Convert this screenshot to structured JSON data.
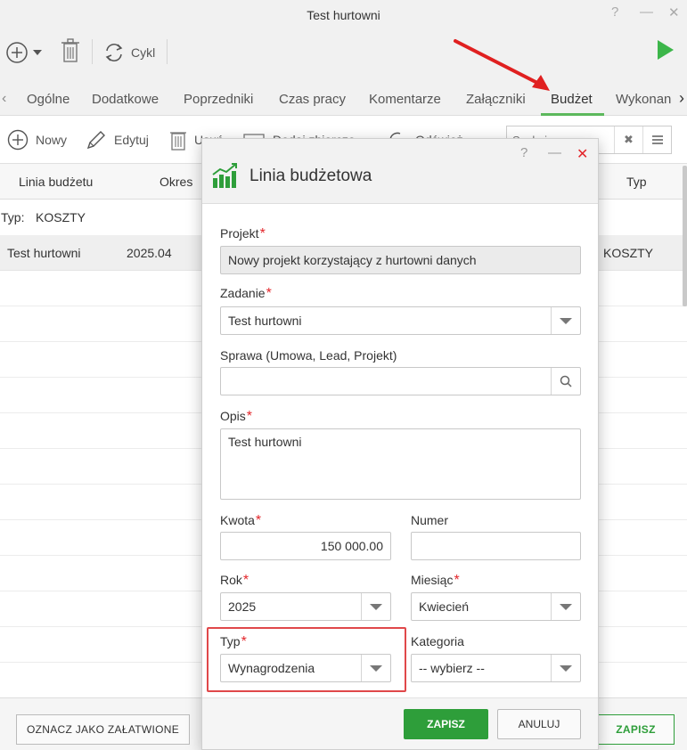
{
  "window": {
    "title": "Test hurtowni",
    "help": "?",
    "minimize": "—",
    "close": "✕"
  },
  "toolbar": {
    "cycle_label": "Cykl"
  },
  "tabs": [
    {
      "label": "Ogólne"
    },
    {
      "label": "Dodatkowe"
    },
    {
      "label": "Poprzedniki"
    },
    {
      "label": "Czas pracy"
    },
    {
      "label": "Komentarze"
    },
    {
      "label": "Załączniki"
    },
    {
      "label": "Budżet"
    },
    {
      "label": "Wykonan"
    }
  ],
  "subtoolbar": {
    "new_label": "Nowy",
    "edit_label": "Edytuj",
    "delete_label": "Usuń",
    "add_label": "Dodaj zbiorczo",
    "refresh_label": "Odśwież",
    "search_placeholder": "Szukaj"
  },
  "grid": {
    "headers": {
      "line": "Linia budżetu",
      "period": "Okres",
      "type": "Typ"
    },
    "group": {
      "label": "Typ:",
      "value": "KOSZTY"
    },
    "row": {
      "line": "Test hurtowni",
      "period": "2025.04",
      "type": "KOSZTY"
    }
  },
  "bottom": {
    "mark_done": "OZNACZ JAKO ZAŁATWIONE",
    "save": "ZAPISZ"
  },
  "modal": {
    "title": "Linia budżetowa",
    "help": "?",
    "minimize": "—",
    "close": "✕",
    "projekt": {
      "label": "Projekt",
      "value": "Nowy projekt korzystający z hurtowni danych"
    },
    "zadanie": {
      "label": "Zadanie",
      "value": "Test hurtowni"
    },
    "sprawa": {
      "label": "Sprawa (Umowa, Lead, Projekt)",
      "value": ""
    },
    "opis": {
      "label": "Opis",
      "value": "Test hurtowni"
    },
    "kwota": {
      "label": "Kwota",
      "value": "150 000.00"
    },
    "numer": {
      "label": "Numer",
      "value": ""
    },
    "rok": {
      "label": "Rok",
      "value": "2025"
    },
    "miesiac": {
      "label": "Miesiąc",
      "value": "Kwiecień"
    },
    "typ": {
      "label": "Typ",
      "value": "Wynagrodzenia"
    },
    "kategoria": {
      "label": "Kategoria",
      "value": "-- wybierz --"
    },
    "save": "ZAPISZ",
    "cancel": "ANULUJ",
    "required_mark": "*"
  },
  "colors": {
    "accent_green": "#2e9e3a",
    "tab_underline": "#5cb85c",
    "required": "#e3262b",
    "annotation_red": "#e0484a"
  }
}
